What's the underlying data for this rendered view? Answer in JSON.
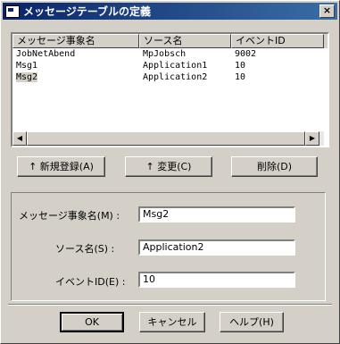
{
  "window": {
    "title": "メッセージテーブルの定義",
    "close_glyph": "×"
  },
  "list": {
    "columns": [
      "メッセージ事象名",
      "ソース名",
      "イベントID"
    ],
    "rows": [
      [
        "JobNetAbend",
        "MpJobsch",
        "9002"
      ],
      [
        "Msg1",
        "Application1",
        "10"
      ],
      [
        "Msg2",
        "Application2",
        "10"
      ]
    ]
  },
  "buttons": {
    "add": "↑ 新規登録(A)",
    "change": "↑ 変更(C)",
    "delete": "削除(D)",
    "ok": "OK",
    "cancel": "キャンセル",
    "help": "ヘルプ(H)"
  },
  "form": {
    "event_name_label": "メッセージ事象名(M) :",
    "event_name_value": "Msg2",
    "source_label": "ソース名(S) :",
    "source_value": "Application2",
    "event_id_label": "イベントID(E) :",
    "event_id_value": "10"
  }
}
